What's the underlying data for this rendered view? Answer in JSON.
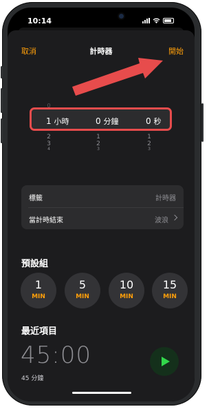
{
  "status": {
    "time": "10:14"
  },
  "nav": {
    "cancel": "取消",
    "title": "計時器",
    "start": "開始"
  },
  "picker": {
    "hours": {
      "value": "1",
      "unit": "小時",
      "above": "0",
      "below": [
        "2",
        "3",
        "4"
      ]
    },
    "minutes": {
      "value": "0",
      "unit": "分鐘",
      "below": [
        "1",
        "2",
        "3"
      ]
    },
    "seconds": {
      "value": "0",
      "unit": "秒",
      "below": [
        "1",
        "2",
        "3"
      ]
    }
  },
  "settings": {
    "label": {
      "title": "標籤",
      "placeholder": "計時器"
    },
    "when_ends": {
      "title": "當計時結束",
      "value": "波浪"
    }
  },
  "presets": {
    "title": "預設組",
    "items": [
      {
        "num": "1",
        "unit": "MIN"
      },
      {
        "num": "5",
        "unit": "MIN"
      },
      {
        "num": "10",
        "unit": "MIN"
      },
      {
        "num": "15",
        "unit": "MIN"
      }
    ]
  },
  "recent": {
    "title": "最近項目",
    "time": "45:00",
    "subtitle": "45 分鐘"
  },
  "colors": {
    "accent": "#ff9f0a",
    "highlight": "#e74c4c",
    "play": "#32d74b"
  }
}
